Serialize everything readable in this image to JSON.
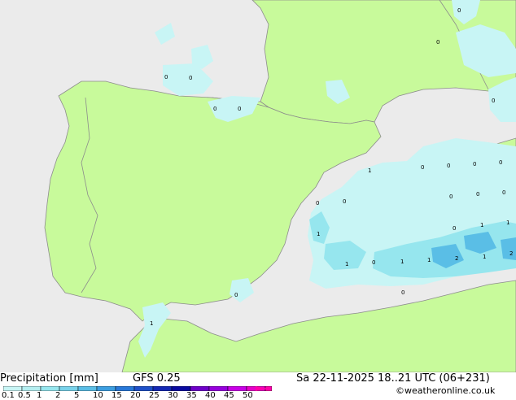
{
  "footer": {
    "product_label": "Precipitation [mm]",
    "model_label": "GFS 0.25",
    "valid_time": "Sa 22-11-2025 18..21 UTC (06+231)",
    "credit": "©weatheronline.co.uk"
  },
  "legend": {
    "ticks": [
      "0.1",
      "0.5",
      "1",
      "2",
      "5",
      "10",
      "15",
      "20",
      "25",
      "30",
      "35",
      "40",
      "45",
      "50"
    ],
    "colors": [
      "#c8f5f5",
      "#b4eef0",
      "#96e6ee",
      "#78d2ea",
      "#5abee6",
      "#3c9ee0",
      "#2878d8",
      "#1e50c8",
      "#1428b4",
      "#0a0aa0",
      "#6e00c8",
      "#9600dc",
      "#c800e6",
      "#e600c8",
      "#ff00aa"
    ]
  },
  "colors": {
    "sea": "#ebebeb",
    "land": "#c8fa9b",
    "border": "#8c8c8c",
    "precip_light": "#c8f5f5",
    "precip_mid": "#96e6ee",
    "precip_heavy": "#5abee6"
  },
  "value_labels": [
    "0",
    "0",
    "0",
    "0",
    "0",
    "0",
    "0",
    "0",
    "0",
    "0",
    "0",
    "0",
    "0",
    "0",
    "0",
    "0",
    "0",
    "0",
    "0",
    "0",
    "1",
    "1",
    "1",
    "1",
    "1",
    "1",
    "1",
    "1",
    "2",
    "2",
    "1"
  ]
}
